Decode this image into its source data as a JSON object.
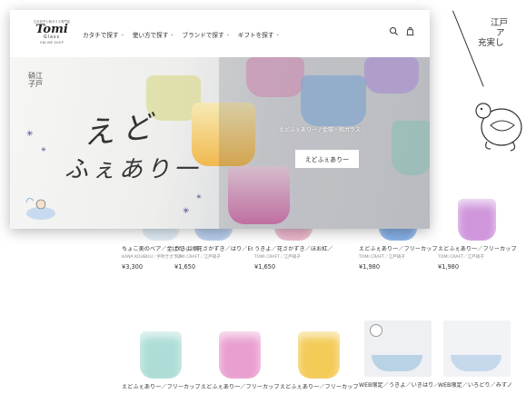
{
  "overlay": {
    "logo": {
      "tagline": "江戸切子と和ガラス専門店",
      "mark": "Tomi",
      "sub": "Glass",
      "shop": "ONLINE SHOP"
    },
    "nav": [
      {
        "label": "カタチで探す"
      },
      {
        "label": "使い方で探す"
      },
      {
        "label": "ブランドで探す"
      },
      {
        "label": "ギフトを探す"
      }
    ],
    "nav_chevron": "⌄",
    "hero": {
      "side_text": "硝江子戸",
      "brush_line1": "えど",
      "brush_line2": "ふぇあり一",
      "caption": "えどふぇあり一 / 金箔・和ガラス",
      "button_label": "えどふぇあり一"
    }
  },
  "background": {
    "deco_text": [
      "江戸",
      "ア",
      "充実し"
    ],
    "products_row1": [
      {
        "name": "ちょこ美のべア／金ぱた／2個セット／ECP11-001",
        "maker": "KANA KOUBOU／手吹きガラス",
        "price": "¥3,300",
        "color": "#d8e6f0"
      },
      {
        "name": "うきよ／花さかずき／はり／EG035-04",
        "maker": "TOMI CRAFT／江戸硝子",
        "price": "¥1,650",
        "color": "#a9c4e8"
      },
      {
        "name": "うきよ／花さかずき／ほお紅／EG035-17",
        "maker": "TOMI CRAFT／江戸硝子",
        "price": "¥1,650",
        "color": "#e8a9c3"
      },
      {
        "name": "えどふぇあり一／フリーカップ／うみ色／EG034-15",
        "maker": "TOMI CRAFT／江戸硝子",
        "price": "¥1,980",
        "color": "#6fa0e0"
      },
      {
        "name": "えどふぇあり一／フリーカップ／てんて／EG034-19",
        "maker": "TOMI CRAFT／江戸硝子",
        "price": "¥1,980",
        "color": "#c784d6"
      }
    ],
    "products_row2": [
      {
        "name": "えどふぇあり一／フリーカップ",
        "color": "#9fd8d0"
      },
      {
        "name": "えどふぇあり一／フリーカップ",
        "color": "#e68fc8"
      },
      {
        "name": "えどふぇあり一／フリーカップ",
        "color": "#f2c23a"
      },
      {
        "name": "WEB限定／うきよ／いきはり／",
        "color": "#b9d3ea"
      },
      {
        "name": "WEB限定／いろどり／みずノ",
        "color": "#c9dcee"
      }
    ]
  }
}
